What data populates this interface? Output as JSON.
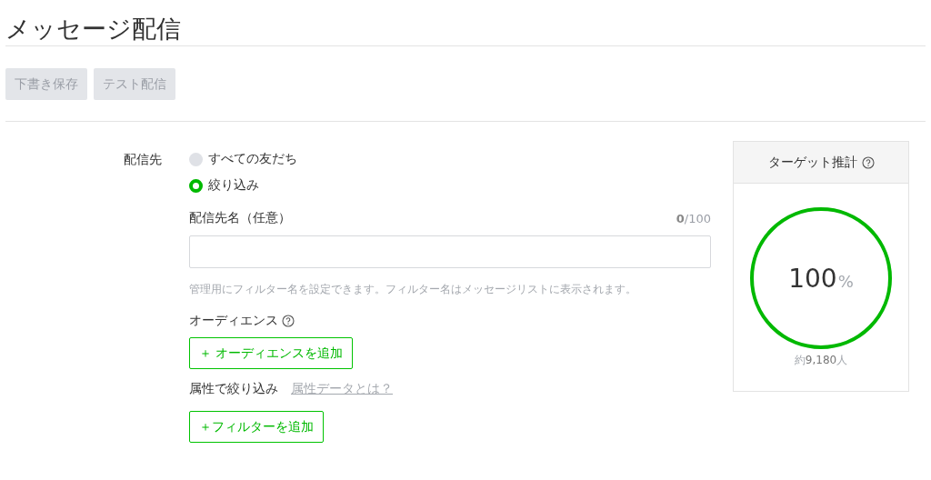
{
  "page_title": "メッセージ配信",
  "toolbar_buttons": [
    {
      "label": "下書き保存",
      "disabled": true
    },
    {
      "label": "テスト配信",
      "disabled": true
    }
  ],
  "recipient": {
    "label": "配信先",
    "options": [
      {
        "label": "すべての友だち",
        "selected": false
      },
      {
        "label": "絞り込み",
        "selected": true
      }
    ]
  },
  "name_field": {
    "label": "配信先名（任意）",
    "counter": "**0**/100",
    "hint": "管理用にフィルター名を設定できます。フィルター名はメッセージリストに表示されます。"
  },
  "audience": {
    "label": "オーディエンス",
    "add_button": "＋ オーディエンスを追加"
  },
  "attribute": {
    "label": "属性で絞り込み",
    "link": "属性データとは？",
    "add_button": "＋フィルターを追加"
  },
  "target_estimate": {
    "title": "ターゲット推計",
    "level": 1,
    "percent": "100",
    "unit": "%",
    "count": "約**9,180**人"
  }
}
